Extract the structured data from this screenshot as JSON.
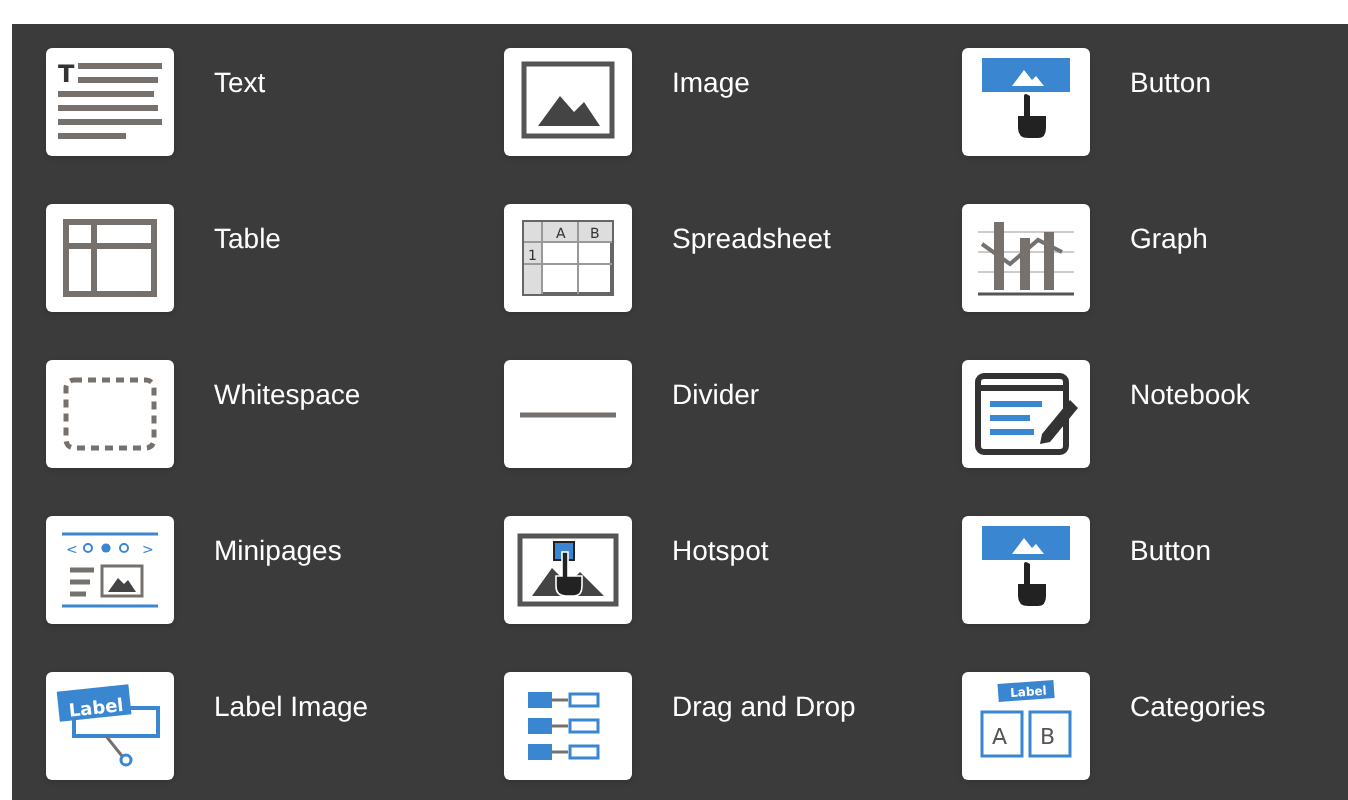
{
  "components": [
    {
      "label": "Text",
      "kind": "text",
      "icon_texts": [
        "T"
      ]
    },
    {
      "label": "Image",
      "kind": "image"
    },
    {
      "label": "Button",
      "kind": "button"
    },
    {
      "label": "Table",
      "kind": "table"
    },
    {
      "label": "Spreadsheet",
      "kind": "spreadsheet",
      "icon_texts": [
        "A",
        "B",
        "1"
      ]
    },
    {
      "label": "Graph",
      "kind": "graph"
    },
    {
      "label": "Whitespace",
      "kind": "whitespace"
    },
    {
      "label": "Divider",
      "kind": "divider"
    },
    {
      "label": "Notebook",
      "kind": "notebook"
    },
    {
      "label": "Minipages",
      "kind": "minipages",
      "icon_texts": [
        "<",
        ">"
      ]
    },
    {
      "label": "Hotspot",
      "kind": "hotspot"
    },
    {
      "label": "Button",
      "kind": "button"
    },
    {
      "label": "Label Image",
      "kind": "labelimage",
      "icon_texts": [
        "Label"
      ]
    },
    {
      "label": "Drag and Drop",
      "kind": "dragdrop"
    },
    {
      "label": "Categories",
      "kind": "categories",
      "icon_texts": [
        "Label",
        "A",
        "B"
      ]
    }
  ]
}
